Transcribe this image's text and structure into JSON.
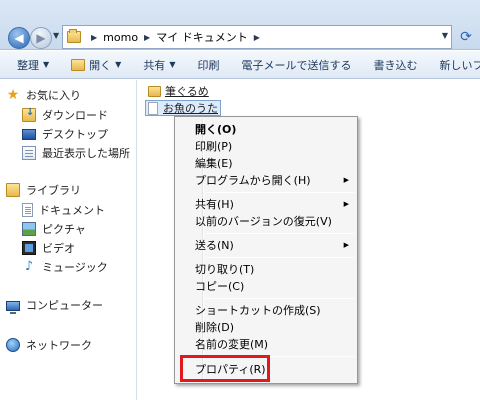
{
  "address_bar": {
    "path": [
      "momo",
      "マイ ドキュメント"
    ],
    "dropdown_icon": "chevron-down-icon",
    "refresh_icon": "refresh-icon"
  },
  "command_bar": {
    "items": [
      "整理",
      "開く",
      "共有",
      "印刷",
      "電子メールで送信する",
      "書き込む",
      "新しいフォル"
    ]
  },
  "nav_pane": {
    "favorites": {
      "label": "お気に入り",
      "children": [
        "ダウンロード",
        "デスクトップ",
        "最近表示した場所"
      ]
    },
    "libraries": {
      "label": "ライブラリ",
      "children": [
        "ドキュメント",
        "ピクチャ",
        "ビデオ",
        "ミュージック"
      ]
    },
    "computer": "コンピューター",
    "network": "ネットワーク"
  },
  "files": [
    {
      "name": "筆ぐるめ",
      "type": "folder"
    },
    {
      "name": "お魚のうた",
      "type": "file",
      "selected": true
    }
  ],
  "context_menu": {
    "items": [
      "開く(O)",
      "印刷(P)",
      "編集(E)",
      "プログラムから開く(H)",
      "共有(H)",
      "以前のバージョンの復元(V)",
      "送る(N)",
      "切り取り(T)",
      "コピー(C)",
      "ショートカットの作成(S)",
      "削除(D)",
      "名前の変更(M)",
      "プロパティ(R)"
    ],
    "highlighted_item": "プロパティ(R)",
    "highlight_color": "#e0191f"
  }
}
